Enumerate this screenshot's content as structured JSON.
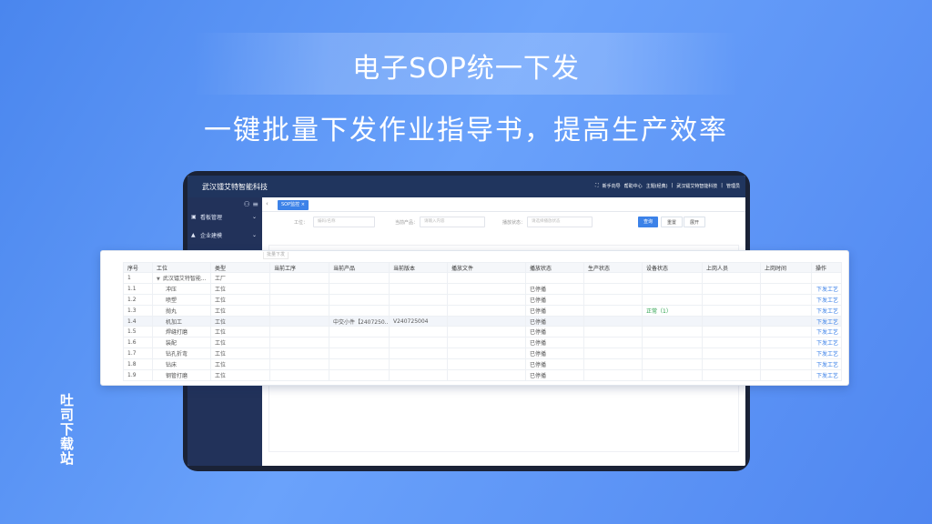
{
  "hero": {
    "title": "电子SOP统一下发",
    "subtitle": "一键批量下发作业指导书，提高生产效率",
    "watermark": "吐司下载站"
  },
  "app": {
    "brand": "武汉镭艾特智能科技",
    "top_actions": [
      "新手向导",
      "帮助中心",
      "主题(经典)",
      "武汉镭艾特智能科技",
      "管理员"
    ],
    "sidebar": {
      "items": [
        {
          "label": "看板管理",
          "icon": "dashboard-icon"
        },
        {
          "label": "企业建模",
          "icon": "user-icon"
        }
      ]
    },
    "tabs": [
      {
        "label": "SOP监控 ×"
      }
    ],
    "filters": {
      "process_label": "工位：",
      "process_placeholder": "编码/名称",
      "product_label": "当前产品：",
      "product_placeholder": "请输入内容",
      "status_label": "播放状态：",
      "status_placeholder": "请选择播放状态",
      "query": "查询",
      "reset": "重置",
      "expand": "展开"
    }
  },
  "table": {
    "tab_hint": "批量下发",
    "headers": [
      "序号",
      "工位",
      "类型",
      "当前工序",
      "当前产品",
      "当前版本",
      "播放文件",
      "播放状态",
      "生产状态",
      "设备状态",
      "上岗人员",
      "上岗时间",
      "操作"
    ],
    "rows": [
      {
        "no": "1",
        "name": "武汉镭艾特智能...",
        "type": "工厂",
        "process": "",
        "product": "",
        "version": "",
        "file": "",
        "play": "",
        "prod": "",
        "device": "",
        "staff": "",
        "time": "",
        "action": "",
        "root": true
      },
      {
        "no": "1.1",
        "name": "冲压",
        "type": "工位",
        "process": "",
        "product": "",
        "version": "",
        "file": "",
        "play": "已停播",
        "prod": "",
        "device": "",
        "staff": "",
        "time": "",
        "action": "下发工艺"
      },
      {
        "no": "1.2",
        "name": "喷塑",
        "type": "工位",
        "process": "",
        "product": "",
        "version": "",
        "file": "",
        "play": "已停播",
        "prod": "",
        "device": "",
        "staff": "",
        "time": "",
        "action": "下发工艺"
      },
      {
        "no": "1.3",
        "name": "抛丸",
        "type": "工位",
        "process": "",
        "product": "",
        "version": "",
        "file": "",
        "play": "已停播",
        "prod": "",
        "device": "正常（1）",
        "staff": "",
        "time": "",
        "action": "下发工艺"
      },
      {
        "no": "1.4",
        "name": "机加工",
        "type": "工位",
        "process": "",
        "product": "中交小件【2407250...",
        "version": "V240725004",
        "file": "",
        "play": "已停播",
        "prod": "",
        "device": "",
        "staff": "",
        "time": "",
        "action": "下发工艺",
        "selected": true
      },
      {
        "no": "1.5",
        "name": "焊缝打磨",
        "type": "工位",
        "process": "",
        "product": "",
        "version": "",
        "file": "",
        "play": "已停播",
        "prod": "",
        "device": "",
        "staff": "",
        "time": "",
        "action": "下发工艺"
      },
      {
        "no": "1.6",
        "name": "装配",
        "type": "工位",
        "process": "",
        "product": "",
        "version": "",
        "file": "",
        "play": "已停播",
        "prod": "",
        "device": "",
        "staff": "",
        "time": "",
        "action": "下发工艺"
      },
      {
        "no": "1.7",
        "name": "钻孔折弯",
        "type": "工位",
        "process": "",
        "product": "",
        "version": "",
        "file": "",
        "play": "已停播",
        "prod": "",
        "device": "",
        "staff": "",
        "time": "",
        "action": "下发工艺"
      },
      {
        "no": "1.8",
        "name": "钻床",
        "type": "工位",
        "process": "",
        "product": "",
        "version": "",
        "file": "",
        "play": "已停播",
        "prod": "",
        "device": "",
        "staff": "",
        "time": "",
        "action": "下发工艺"
      },
      {
        "no": "1.9",
        "name": "钢管打磨",
        "type": "工位",
        "process": "",
        "product": "",
        "version": "",
        "file": "",
        "play": "已停播",
        "prod": "",
        "device": "",
        "staff": "",
        "time": "",
        "action": "下发工艺"
      }
    ]
  }
}
